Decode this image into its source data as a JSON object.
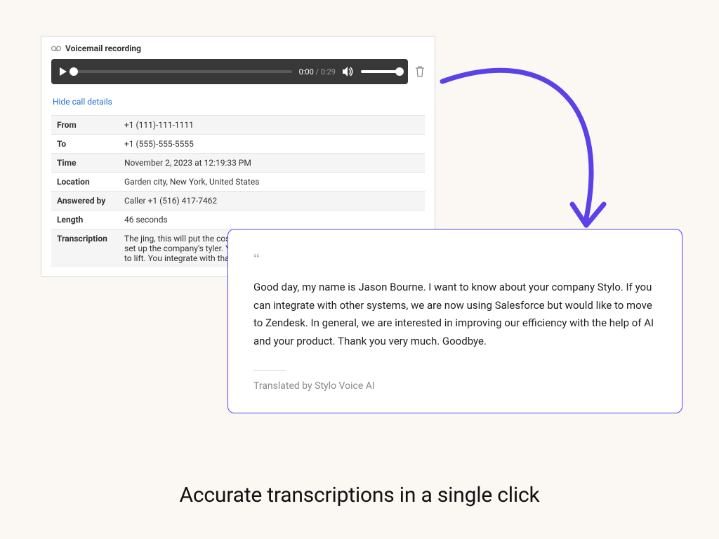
{
  "voicemail": {
    "header": "Voicemail recording",
    "player": {
      "current_time": "0:00",
      "duration": "0:29"
    },
    "hide_link": "Hide call details",
    "details": {
      "from": {
        "label": "From",
        "value": "+1 (111)-111-1111"
      },
      "to": {
        "label": "To",
        "value": "+1 (555)-555-5555"
      },
      "time": {
        "label": "Time",
        "value": "November 2, 2023 at 12:19:33 PM"
      },
      "location": {
        "label": "Location",
        "value": "Garden city, New York, United States"
      },
      "answered_by": {
        "label": "Answered by",
        "value": "Caller +1 (516) 417-7462"
      },
      "length": {
        "label": "Length",
        "value": "46 seconds"
      },
      "transcription": {
        "label": "Transcription",
        "value": "The jing, this will put the cost to your for choosing back forward to us. So we'll set up the company's tyler. Yahoo choose the custom kibbler again for, for us to lift. You integrate with that. Give us a simple o                                                                                        sell them into this, the ocea"
      }
    }
  },
  "output": {
    "quote_text": "Good day, my name is Jason Bourne. I want to know about your company Stylo. If you can integrate with other systems, we are now using Salesforce but would like to move to Zendesk. In general, we are interested in improving our efficiency with the help of AI and your product. Thank you very much. Goodbye.",
    "attribution": "Translated by Stylo Voice AI"
  },
  "tagline": "Accurate transcriptions in a single click",
  "colors": {
    "accent": "#5a41e8"
  }
}
